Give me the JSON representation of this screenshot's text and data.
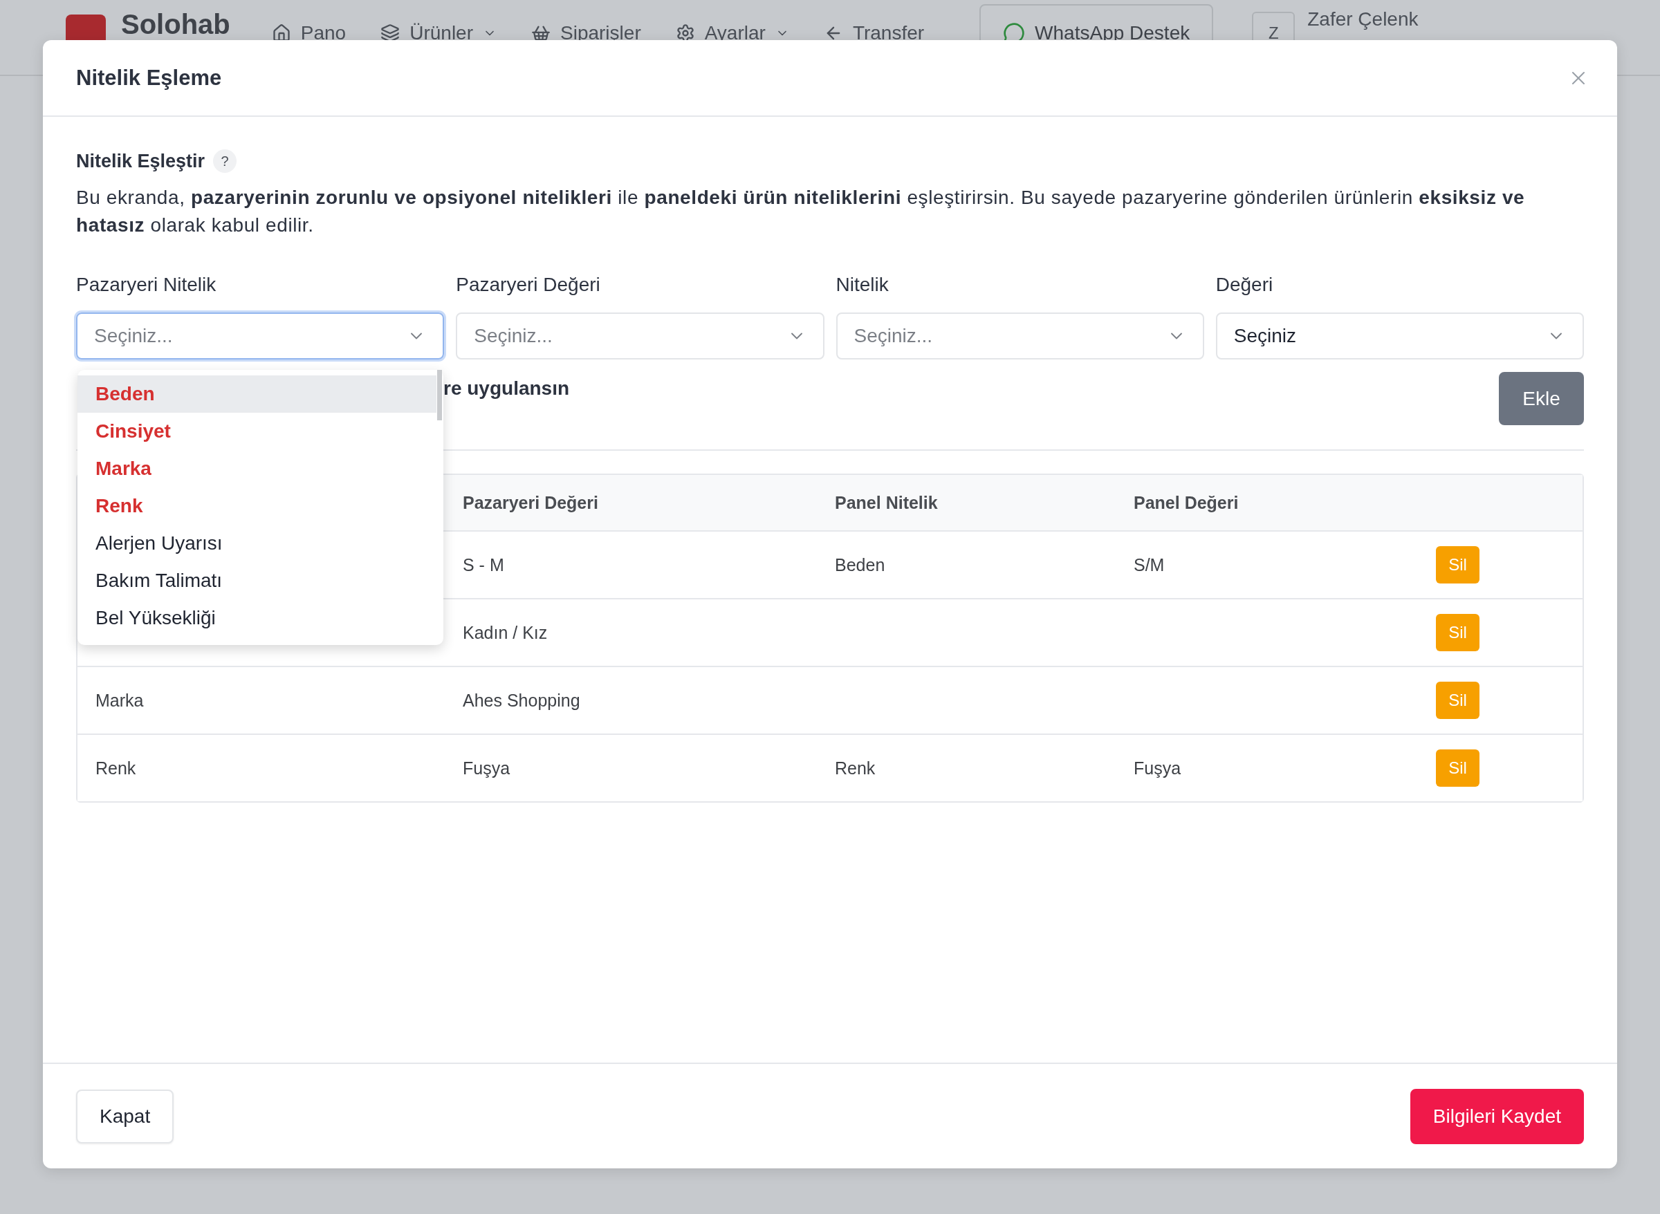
{
  "app_header": {
    "brand": "Solohab",
    "nav": [
      {
        "label": "Pano",
        "dropdown": false
      },
      {
        "label": "Ürünler",
        "dropdown": true
      },
      {
        "label": "Siparişler",
        "dropdown": false
      },
      {
        "label": "Ayarlar",
        "dropdown": true
      },
      {
        "label": "Transfer",
        "dropdown": false
      }
    ],
    "support_button": "WhatsApp Destek",
    "user": {
      "initial": "Z",
      "name": "Zafer Çelenk"
    }
  },
  "modal": {
    "title": "Nitelik Eşleme",
    "section_title": "Nitelik Eşleştir",
    "help": "?",
    "description": "Bu ekranda, **pazaryerinin zorunlu ve opsiyonel nitelikleri** ile **paneldeki ürün niteliklerini** eşleştirirsin. Bu sayede pazaryerine gönderilen ürünlerin **eksiksiz ve hatasız** olarak kabul edilir.",
    "fields": [
      {
        "label": "Pazaryeri Nitelik",
        "placeholder": "Seçiniz...",
        "focused": true
      },
      {
        "label": "Pazaryeri Değeri",
        "placeholder": "Seçiniz...",
        "focused": false
      },
      {
        "label": "Nitelik",
        "placeholder": "Seçiniz...",
        "focused": false
      },
      {
        "label": "Değeri",
        "value": "Seçiniz",
        "focused": false
      }
    ],
    "dropdown": {
      "items": [
        {
          "label": "Beden",
          "required": true,
          "highlighted": true
        },
        {
          "label": "Cinsiyet",
          "required": true,
          "highlighted": false
        },
        {
          "label": "Marka",
          "required": true,
          "highlighted": false
        },
        {
          "label": "Renk",
          "required": true,
          "highlighted": false
        },
        {
          "label": "Alerjen Uyarısı",
          "required": false,
          "highlighted": false
        },
        {
          "label": "Bakım Talimatı",
          "required": false,
          "highlighted": false
        },
        {
          "label": "Bel Yüksekliği",
          "required": false,
          "highlighted": false
        }
      ]
    },
    "apply_label": "re uygulansın",
    "add_button": "Ekle",
    "table": {
      "columns": [
        "Pazaryeri Değeri",
        "Panel Nitelik",
        "Panel Değeri"
      ],
      "rows": [
        {
          "marketplace_value": "S - M",
          "panel_attribute": "Beden",
          "panel_value": "S/M",
          "action": "Sil"
        },
        {
          "marketplace_value": "Kadın / Kız",
          "action": "Sil"
        },
        {
          "marketplace_attribute": "Marka",
          "marketplace_value": "Ahes Shopping",
          "action": "Sil"
        },
        {
          "marketplace_attribute": "Renk",
          "marketplace_value": "Fuşya",
          "panel_attribute": "Renk",
          "panel_value": "Fuşya",
          "action": "Sil"
        }
      ]
    },
    "footer": {
      "close_button": "Kapat",
      "save_button": "Bilgileri Kaydet"
    }
  }
}
